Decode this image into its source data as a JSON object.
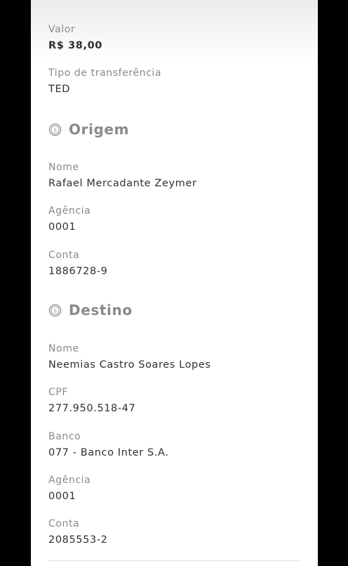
{
  "transfer": {
    "valor_label": "Valor",
    "valor": "R$ 38,00",
    "tipo_label": "Tipo de transferência",
    "tipo": "TED"
  },
  "origem": {
    "title": "Origem",
    "icon": "coin-icon",
    "nome_label": "Nome",
    "nome": "Rafael Mercadante Zeymer",
    "agencia_label": "Agência",
    "agencia": "0001",
    "conta_label": "Conta",
    "conta": "1886728-9"
  },
  "destino": {
    "title": "Destino",
    "icon": "coin-icon",
    "nome_label": "Nome",
    "nome": "Neemias Castro Soares Lopes",
    "cpf_label": "CPF",
    "cpf": "277.950.518-47",
    "banco_label": "Banco",
    "banco": "077 - Banco Inter S.A.",
    "agencia_label": "Agência",
    "agencia": "0001",
    "conta_label": "Conta",
    "conta": "2085553-2"
  }
}
